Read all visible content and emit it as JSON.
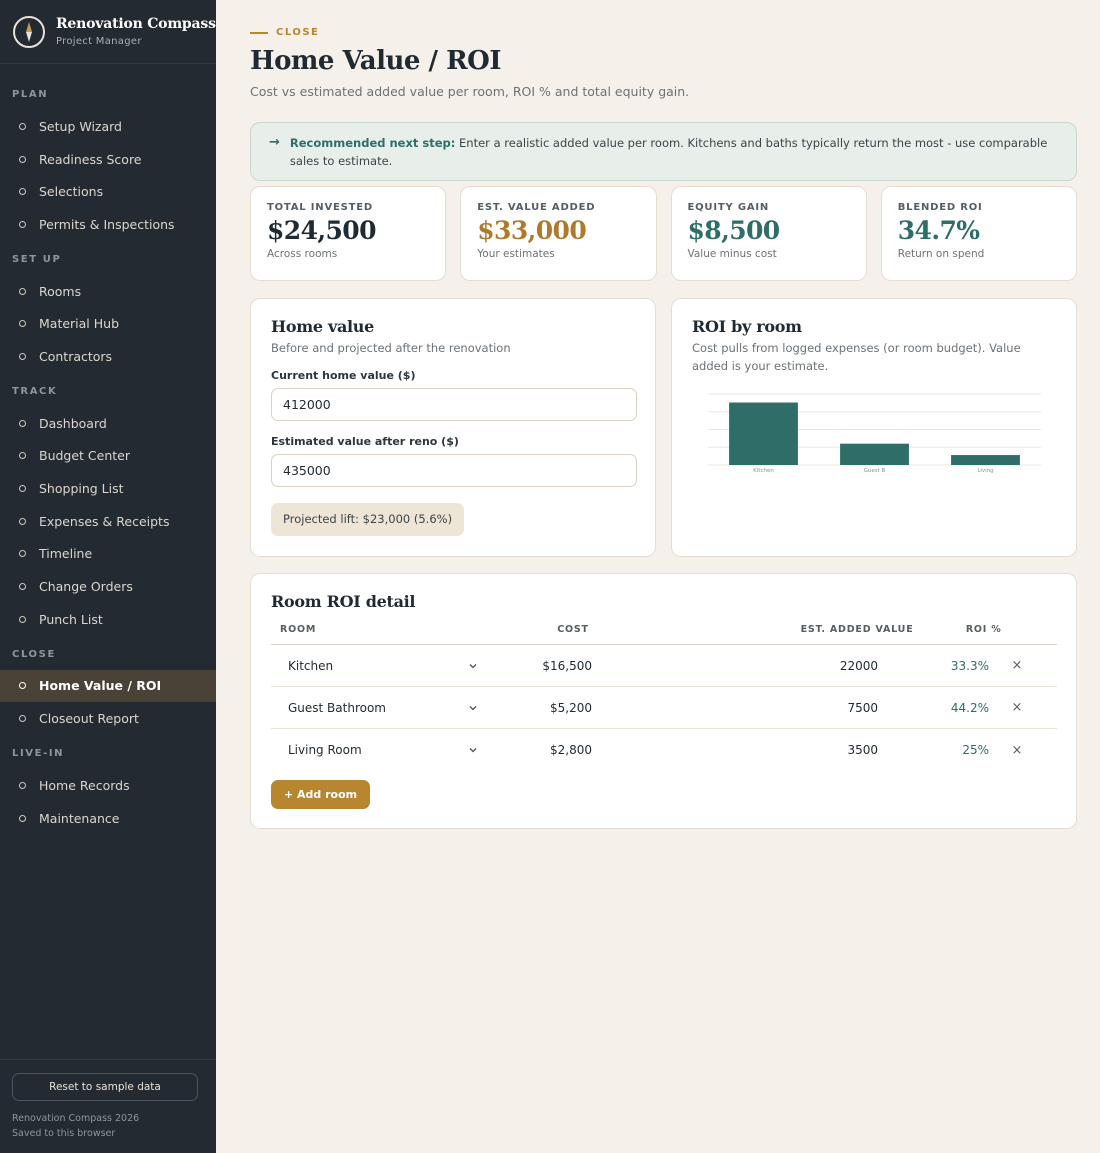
{
  "brand": {
    "title": "Renovation Compass",
    "subtitle": "Project Manager"
  },
  "nav": {
    "sections": [
      {
        "label": "PLAN",
        "items": [
          "Setup Wizard",
          "Readiness Score",
          "Selections",
          "Permits & Inspections"
        ]
      },
      {
        "label": "SET UP",
        "items": [
          "Rooms",
          "Material Hub",
          "Contractors"
        ]
      },
      {
        "label": "TRACK",
        "items": [
          "Dashboard",
          "Budget Center",
          "Shopping List",
          "Expenses & Receipts",
          "Timeline",
          "Change Orders",
          "Punch List"
        ]
      },
      {
        "label": "CLOSE",
        "items": [
          "Home Value / ROI",
          "Closeout Report"
        ]
      },
      {
        "label": "LIVE-IN",
        "items": [
          "Home Records",
          "Maintenance"
        ]
      }
    ],
    "active": "Home Value / ROI"
  },
  "footer": {
    "reset_label": "Reset to sample data",
    "line1": "Renovation Compass 2026",
    "line2": "Saved to this browser"
  },
  "header": {
    "eyebrow": "CLOSE",
    "title": "Home Value / ROI",
    "subtitle": "Cost vs estimated added value per room, ROI % and total equity gain."
  },
  "callout": {
    "lead": "Recommended next step:",
    "text": " Enter a realistic added value per room. Kitchens and baths typically return the most - use comparable sales to estimate."
  },
  "stats": [
    {
      "label": "TOTAL INVESTED",
      "value": "$24,500",
      "note": "Across rooms",
      "color": "#1f2a33"
    },
    {
      "label": "EST. VALUE ADDED",
      "value": "$33,000",
      "note": "Your estimates",
      "color": "#b07a2c"
    },
    {
      "label": "EQUITY GAIN",
      "value": "$8,500",
      "note": "Value minus cost",
      "color": "#2e6d68"
    },
    {
      "label": "BLENDED ROI",
      "value": "34.7%",
      "note": "Return on spend",
      "color": "#2e6d68"
    }
  ],
  "home_value": {
    "title": "Home value",
    "subtitle": "Before and projected after the renovation",
    "current_label": "Current home value ($)",
    "current_value": "412000",
    "after_label": "Estimated value after reno ($)",
    "after_value": "435000",
    "lift": "Projected lift: $23,000 (5.6%)"
  },
  "roi_chart": {
    "title": "ROI by room",
    "subtitle": "Cost pulls from logged expenses (or room budget). Value added is your estimate."
  },
  "chart_data": {
    "type": "bar",
    "categories": [
      "Kitchen",
      "Guest B",
      "Living"
    ],
    "values": [
      22000,
      7500,
      3500
    ],
    "ylim": [
      0,
      25000
    ],
    "grid": true,
    "color": "#2e6d68"
  },
  "detail": {
    "title": "Room ROI detail",
    "columns": {
      "room": "ROOM",
      "cost": "COST",
      "value": "EST. ADDED VALUE",
      "roi": "ROI %"
    },
    "rows": [
      {
        "room": "Kitchen",
        "cost": "$16,500",
        "value": "22000",
        "roi": "33.3%"
      },
      {
        "room": "Guest Bathroom",
        "cost": "$5,200",
        "value": "7500",
        "roi": "44.2%"
      },
      {
        "room": "Living Room",
        "cost": "$2,800",
        "value": "3500",
        "roi": "25%"
      }
    ],
    "delete_glyph": "×",
    "add_label": "+ Add room"
  }
}
